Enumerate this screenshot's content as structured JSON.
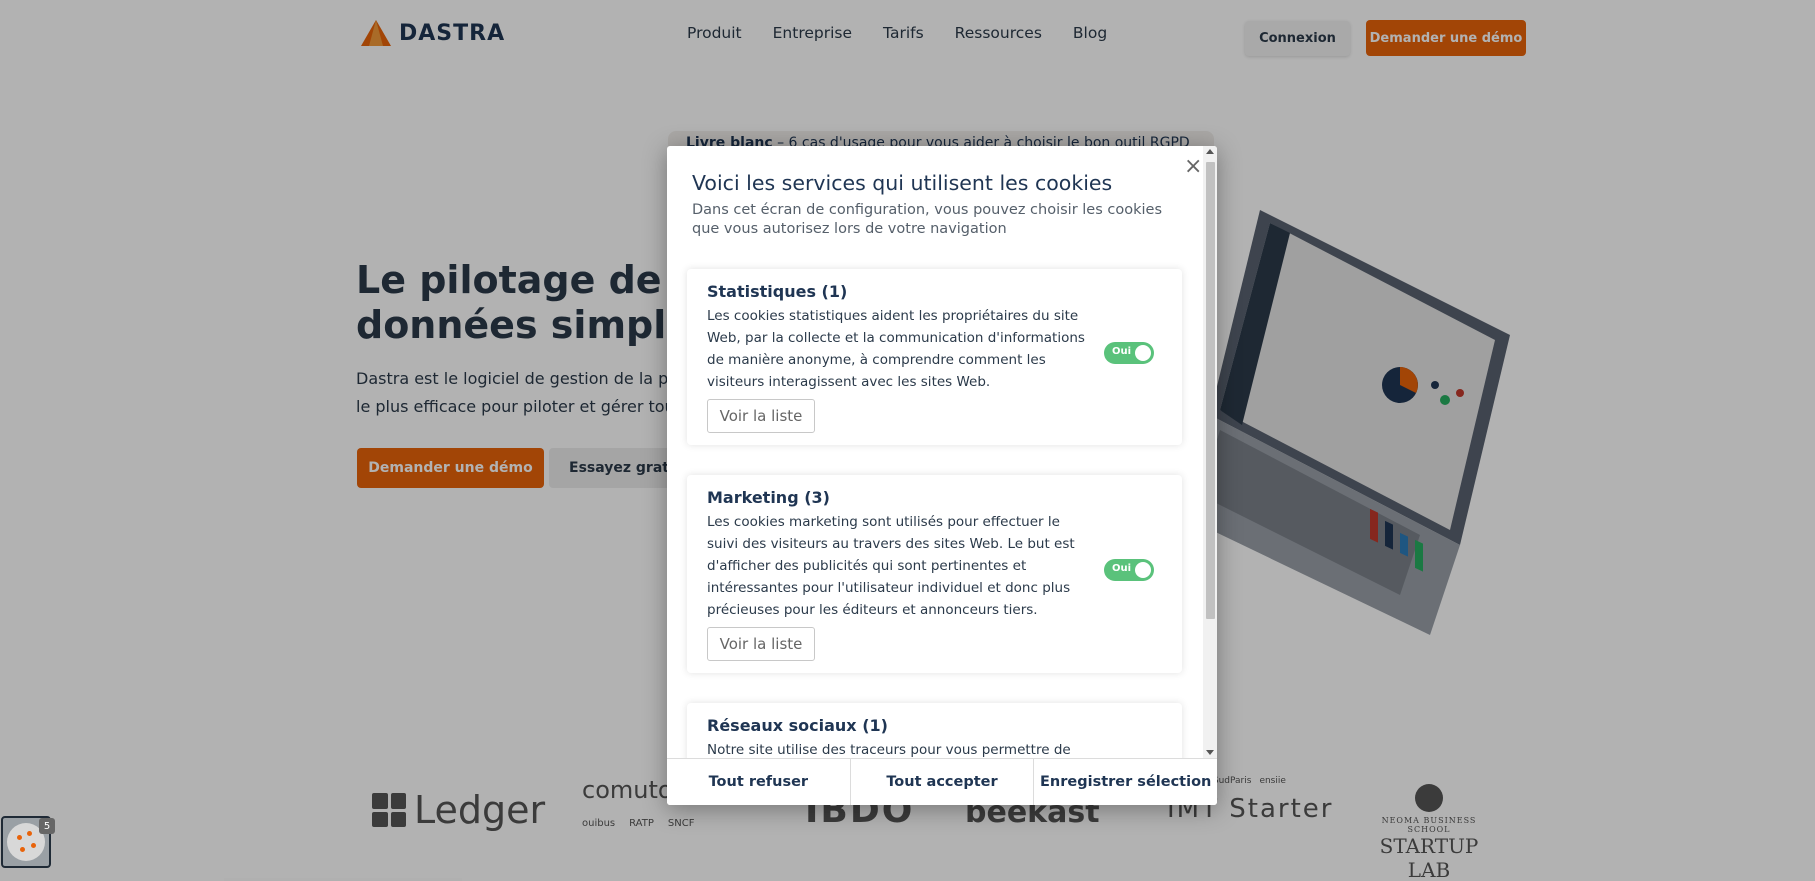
{
  "nav": {
    "brand": "DASTRA",
    "links": [
      "Produit",
      "Entreprise",
      "Tarifs",
      "Ressources",
      "Blog"
    ],
    "login_label": "Connexion",
    "demo_label": "Demander une démo"
  },
  "banner": {
    "emphasis": "Livre blanc",
    "text": " – 6 cas d'usage pour vous aider à choisir le bon outil RGPD"
  },
  "hero": {
    "title_line1": "Le pilotage de la conformité",
    "title_line2": "données simplement",
    "sub_line1": "Dastra est le logiciel de gestion de la protection",
    "sub_line2": "le plus efficace pour piloter et gérer toutes",
    "demo_label": "Demander une démo",
    "try_label": "Essayez gratuitement"
  },
  "partners": {
    "ledger": "Ledger",
    "comuto": "comuto",
    "comuto_subs": [
      "ouibus",
      "RATP",
      "SNCF"
    ],
    "bdo": "IBDO",
    "beekast": "beekast",
    "imt_top": [
      "TELECOM SudParis",
      "ensiie"
    ],
    "imt": "IMT Starter",
    "startup_small": "NEOMA BUSINESS SCHOOL",
    "startup": "STARTUP LAB"
  },
  "cookie_widget": {
    "badge": "5"
  },
  "modal": {
    "close_symbol": "×",
    "title": "Voici les services qui utilisent les cookies",
    "description": "Dans cet écran de configuration, vous pouvez choisir les cookies que vous autorisez lors de votre navigation",
    "cards": [
      {
        "title": "Statistiques (1)",
        "description": "Les cookies statistiques aident les propriétaires du site Web, par la collecte et la communication d'informations de manière anonyme, à comprendre comment les visiteurs interagissent avec les sites Web.",
        "link": "Voir la liste",
        "toggle": "Oui"
      },
      {
        "title": "Marketing (3)",
        "description": "Les cookies marketing sont utilisés pour effectuer le suivi des visiteurs au travers des sites Web. Le but est d'afficher des publicités qui sont pertinentes et intéressantes pour l'utilisateur individuel et donc plus précieuses pour les éditeurs et annonceurs tiers.",
        "link": "Voir la liste",
        "toggle": "Oui"
      },
      {
        "title": "Réseaux sociaux (1)",
        "description": "Notre site utilise des traceurs pour vous permettre de"
      }
    ],
    "footer": {
      "refuse": "Tout refuser",
      "accept": "Tout accepter",
      "save": "Enregistrer sélection"
    }
  },
  "colors": {
    "brand_orange": "#e8630a",
    "navy": "#1f3553",
    "toggle_green": "#5ac27b"
  }
}
